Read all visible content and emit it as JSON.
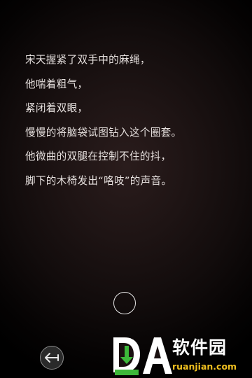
{
  "story": {
    "lines": [
      "宋天握紧了双手中的麻绳，",
      "他喘着粗气，",
      "紧闭着双眼，",
      "慢慢的将脑袋试图钻入这个圈套。",
      "他微曲的双腿在控制不住的抖，",
      "脚下的木椅发出“咯吱”的声音。"
    ]
  },
  "controls": {
    "next_icon": "circle-icon",
    "back_icon": "back-arrow-icon"
  },
  "watermark": {
    "title": "软件园",
    "url": "ruanjian.com",
    "logo_letters": "DA",
    "colors": {
      "green": "#3db83a",
      "yellow": "#f0c020",
      "white": "#ffffff"
    }
  },
  "colors": {
    "text": "#e6e0de",
    "background_center": "#2a1c1c",
    "background_edge": "#000000"
  }
}
